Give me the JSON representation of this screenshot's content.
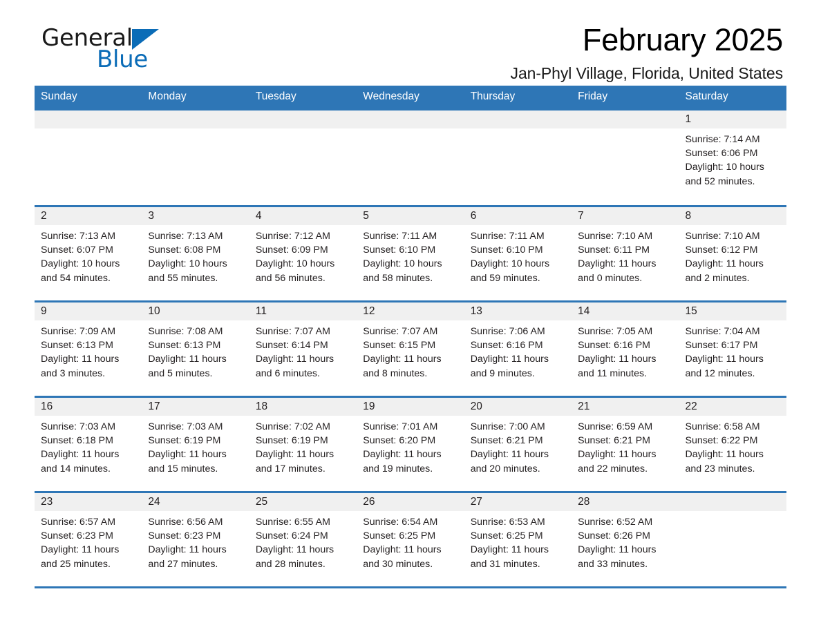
{
  "brand": {
    "word_general": "General",
    "word_blue": "Blue",
    "logo_icon": "triangle-flag-icon",
    "accent_color": "#0b6cb7"
  },
  "header": {
    "month_title": "February 2025",
    "location": "Jan-Phyl Village, Florida, United States"
  },
  "theme": {
    "header_blue": "#2e76b6",
    "daynum_band": "#f0f0f0",
    "text": "#231f20"
  },
  "calendar": {
    "weekday_headers": [
      "Sunday",
      "Monday",
      "Tuesday",
      "Wednesday",
      "Thursday",
      "Friday",
      "Saturday"
    ],
    "weeks": [
      [
        {
          "day": "",
          "lines": []
        },
        {
          "day": "",
          "lines": []
        },
        {
          "day": "",
          "lines": []
        },
        {
          "day": "",
          "lines": []
        },
        {
          "day": "",
          "lines": []
        },
        {
          "day": "",
          "lines": []
        },
        {
          "day": "1",
          "lines": [
            "Sunrise: 7:14 AM",
            "Sunset: 6:06 PM",
            "Daylight: 10 hours",
            "and 52 minutes."
          ]
        }
      ],
      [
        {
          "day": "2",
          "lines": [
            "Sunrise: 7:13 AM",
            "Sunset: 6:07 PM",
            "Daylight: 10 hours",
            "and 54 minutes."
          ]
        },
        {
          "day": "3",
          "lines": [
            "Sunrise: 7:13 AM",
            "Sunset: 6:08 PM",
            "Daylight: 10 hours",
            "and 55 minutes."
          ]
        },
        {
          "day": "4",
          "lines": [
            "Sunrise: 7:12 AM",
            "Sunset: 6:09 PM",
            "Daylight: 10 hours",
            "and 56 minutes."
          ]
        },
        {
          "day": "5",
          "lines": [
            "Sunrise: 7:11 AM",
            "Sunset: 6:10 PM",
            "Daylight: 10 hours",
            "and 58 minutes."
          ]
        },
        {
          "day": "6",
          "lines": [
            "Sunrise: 7:11 AM",
            "Sunset: 6:10 PM",
            "Daylight: 10 hours",
            "and 59 minutes."
          ]
        },
        {
          "day": "7",
          "lines": [
            "Sunrise: 7:10 AM",
            "Sunset: 6:11 PM",
            "Daylight: 11 hours",
            "and 0 minutes."
          ]
        },
        {
          "day": "8",
          "lines": [
            "Sunrise: 7:10 AM",
            "Sunset: 6:12 PM",
            "Daylight: 11 hours",
            "and 2 minutes."
          ]
        }
      ],
      [
        {
          "day": "9",
          "lines": [
            "Sunrise: 7:09 AM",
            "Sunset: 6:13 PM",
            "Daylight: 11 hours",
            "and 3 minutes."
          ]
        },
        {
          "day": "10",
          "lines": [
            "Sunrise: 7:08 AM",
            "Sunset: 6:13 PM",
            "Daylight: 11 hours",
            "and 5 minutes."
          ]
        },
        {
          "day": "11",
          "lines": [
            "Sunrise: 7:07 AM",
            "Sunset: 6:14 PM",
            "Daylight: 11 hours",
            "and 6 minutes."
          ]
        },
        {
          "day": "12",
          "lines": [
            "Sunrise: 7:07 AM",
            "Sunset: 6:15 PM",
            "Daylight: 11 hours",
            "and 8 minutes."
          ]
        },
        {
          "day": "13",
          "lines": [
            "Sunrise: 7:06 AM",
            "Sunset: 6:16 PM",
            "Daylight: 11 hours",
            "and 9 minutes."
          ]
        },
        {
          "day": "14",
          "lines": [
            "Sunrise: 7:05 AM",
            "Sunset: 6:16 PM",
            "Daylight: 11 hours",
            "and 11 minutes."
          ]
        },
        {
          "day": "15",
          "lines": [
            "Sunrise: 7:04 AM",
            "Sunset: 6:17 PM",
            "Daylight: 11 hours",
            "and 12 minutes."
          ]
        }
      ],
      [
        {
          "day": "16",
          "lines": [
            "Sunrise: 7:03 AM",
            "Sunset: 6:18 PM",
            "Daylight: 11 hours",
            "and 14 minutes."
          ]
        },
        {
          "day": "17",
          "lines": [
            "Sunrise: 7:03 AM",
            "Sunset: 6:19 PM",
            "Daylight: 11 hours",
            "and 15 minutes."
          ]
        },
        {
          "day": "18",
          "lines": [
            "Sunrise: 7:02 AM",
            "Sunset: 6:19 PM",
            "Daylight: 11 hours",
            "and 17 minutes."
          ]
        },
        {
          "day": "19",
          "lines": [
            "Sunrise: 7:01 AM",
            "Sunset: 6:20 PM",
            "Daylight: 11 hours",
            "and 19 minutes."
          ]
        },
        {
          "day": "20",
          "lines": [
            "Sunrise: 7:00 AM",
            "Sunset: 6:21 PM",
            "Daylight: 11 hours",
            "and 20 minutes."
          ]
        },
        {
          "day": "21",
          "lines": [
            "Sunrise: 6:59 AM",
            "Sunset: 6:21 PM",
            "Daylight: 11 hours",
            "and 22 minutes."
          ]
        },
        {
          "day": "22",
          "lines": [
            "Sunrise: 6:58 AM",
            "Sunset: 6:22 PM",
            "Daylight: 11 hours",
            "and 23 minutes."
          ]
        }
      ],
      [
        {
          "day": "23",
          "lines": [
            "Sunrise: 6:57 AM",
            "Sunset: 6:23 PM",
            "Daylight: 11 hours",
            "and 25 minutes."
          ]
        },
        {
          "day": "24",
          "lines": [
            "Sunrise: 6:56 AM",
            "Sunset: 6:23 PM",
            "Daylight: 11 hours",
            "and 27 minutes."
          ]
        },
        {
          "day": "25",
          "lines": [
            "Sunrise: 6:55 AM",
            "Sunset: 6:24 PM",
            "Daylight: 11 hours",
            "and 28 minutes."
          ]
        },
        {
          "day": "26",
          "lines": [
            "Sunrise: 6:54 AM",
            "Sunset: 6:25 PM",
            "Daylight: 11 hours",
            "and 30 minutes."
          ]
        },
        {
          "day": "27",
          "lines": [
            "Sunrise: 6:53 AM",
            "Sunset: 6:25 PM",
            "Daylight: 11 hours",
            "and 31 minutes."
          ]
        },
        {
          "day": "28",
          "lines": [
            "Sunrise: 6:52 AM",
            "Sunset: 6:26 PM",
            "Daylight: 11 hours",
            "and 33 minutes."
          ]
        },
        {
          "day": "",
          "lines": []
        }
      ]
    ]
  }
}
